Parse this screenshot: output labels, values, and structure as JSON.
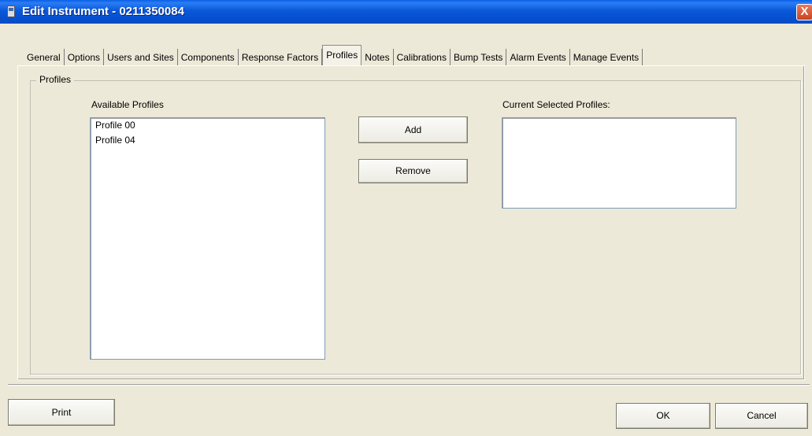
{
  "window": {
    "title": "Edit Instrument - 0211350084",
    "close_glyph": "X"
  },
  "tabs": [
    {
      "label": "General"
    },
    {
      "label": "Options"
    },
    {
      "label": "Users and Sites"
    },
    {
      "label": "Components"
    },
    {
      "label": "Response Factors"
    },
    {
      "label": "Profiles",
      "active": true
    },
    {
      "label": "Notes"
    },
    {
      "label": "Calibrations"
    },
    {
      "label": "Bump Tests"
    },
    {
      "label": "Alarm Events"
    },
    {
      "label": "Manage Events"
    }
  ],
  "profiles_group": {
    "legend": "Profiles",
    "available_label": "Available Profiles",
    "available_items": [
      "Profile 00",
      "Profile 04"
    ],
    "selected_label": "Current Selected Profiles:",
    "selected_items": [],
    "add_label": "Add",
    "remove_label": "Remove"
  },
  "footer": {
    "print_label": "Print",
    "ok_label": "OK",
    "cancel_label": "Cancel"
  },
  "icons": {
    "app": "instrument-icon",
    "close": "close-icon"
  }
}
